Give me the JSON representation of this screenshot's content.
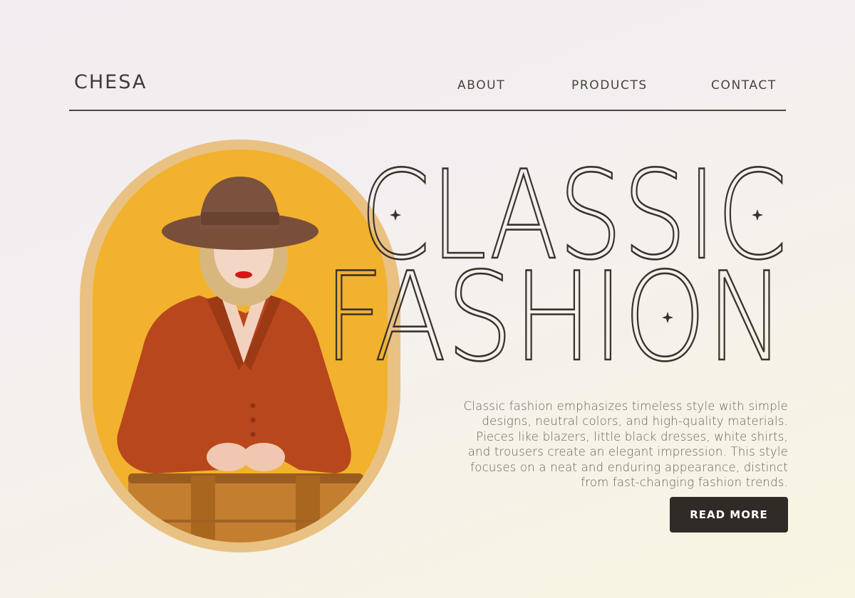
{
  "header": {
    "brand": "CHESA",
    "nav": [
      "ABOUT",
      "PRODUCTS",
      "CONTACT"
    ]
  },
  "hero": {
    "headline_line1": "CLASSIC",
    "headline_line2": "FASHION",
    "description": "Classic fashion emphasizes timeless style with simple designs, neutral colors, and high-quality materials. Pieces like blazers, little black dresses, white shirts, and trousers create an elegant impression. This style focuses on a neat and enduring appearance, distinct from fast-changing fashion trends.",
    "button_label": "READ MORE",
    "image_subject": "woman in brown hat and rust dress holding a tan suitcase"
  },
  "colors": {
    "background": "#f3efe9",
    "text": "#3b342d",
    "frame": "#e9c183",
    "photo_background": "#f2b22d",
    "dress": "#b9481e",
    "suitcase": "#c8812f",
    "button": "#312b27"
  },
  "icons": [
    "sparkle-icon"
  ]
}
